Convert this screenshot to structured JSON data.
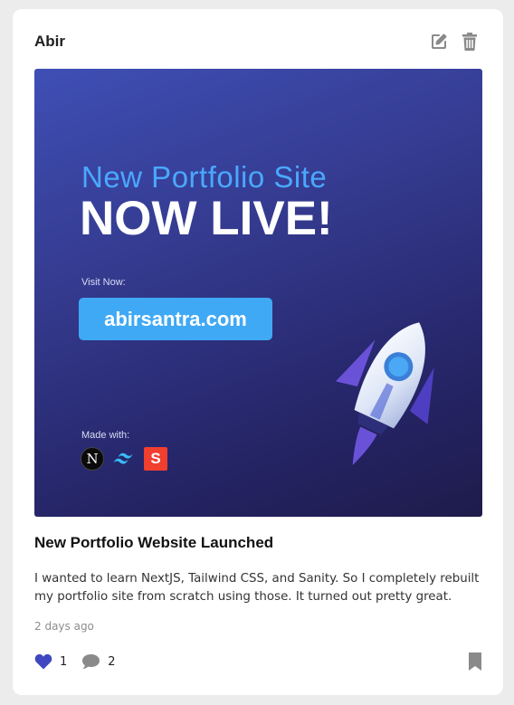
{
  "post": {
    "author": "Abir",
    "title": "New Portfolio Website Launched",
    "description": "I wanted to learn NextJS, Tailwind CSS, and Sanity. So I completely rebuilt my portfolio site from scratch using those. It turned out pretty great.",
    "time_ago": "2 days ago",
    "likes": "1",
    "comments": "2",
    "icons": {
      "edit": "edit-icon",
      "delete": "trash-icon",
      "like": "heart-icon",
      "comment": "comment-icon",
      "bookmark": "bookmark-icon"
    }
  },
  "banner": {
    "subtitle": "New Portfolio Site",
    "headline": "NOW LIVE!",
    "visit_label": "Visit Now:",
    "url": "abirsantra.com",
    "made_with_label": "Made with:",
    "logo_next_letter": "N",
    "logo_sanity_letter": "S",
    "logos": [
      "nextjs-logo",
      "tailwind-logo",
      "sanity-logo"
    ]
  },
  "colors": {
    "like": "#3f48c0",
    "icon_gray": "#8a8a8a",
    "accent_blue": "#3fa9f5"
  }
}
